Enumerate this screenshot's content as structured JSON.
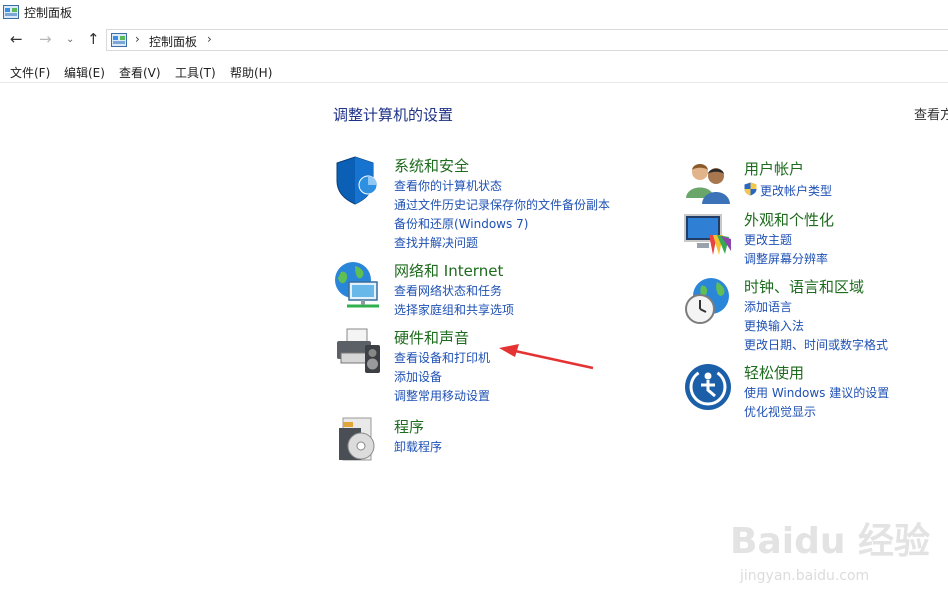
{
  "window": {
    "title": "控制面板"
  },
  "nav": {
    "breadcrumb": "控制面板"
  },
  "menu": [
    "文件(F)",
    "编辑(E)",
    "查看(V)",
    "工具(T)",
    "帮助(H)"
  ],
  "content": {
    "heading": "调整计算机的设置",
    "view_by": "查看方",
    "left_categories": [
      {
        "title": "系统和安全",
        "icon": "shield-icon",
        "links": [
          "查看你的计算机状态",
          "通过文件历史记录保存你的文件备份副本",
          "备份和还原(Windows 7)",
          "查找并解决问题"
        ]
      },
      {
        "title": "网络和 Internet",
        "icon": "network-globe-icon",
        "links": [
          "查看网络状态和任务",
          "选择家庭组和共享选项"
        ]
      },
      {
        "title": "硬件和声音",
        "icon": "printer-speaker-icon",
        "links": [
          "查看设备和打印机",
          "添加设备",
          "调整常用移动设置"
        ]
      },
      {
        "title": "程序",
        "icon": "programs-disc-icon",
        "links": [
          "卸载程序"
        ]
      }
    ],
    "right_categories": [
      {
        "title": "用户帐户",
        "icon": "users-icon",
        "links": [
          "更改帐户类型"
        ]
      },
      {
        "title": "外观和个性化",
        "icon": "monitor-palette-icon",
        "links": [
          "更改主题",
          "调整屏幕分辨率"
        ]
      },
      {
        "title": "时钟、语言和区域",
        "icon": "globe-clock-icon",
        "links": [
          "添加语言",
          "更换输入法",
          "更改日期、时间或数字格式"
        ]
      },
      {
        "title": "轻松使用",
        "icon": "ease-of-access-icon",
        "links": [
          "使用 Windows 建议的设置",
          "优化视觉显示"
        ]
      }
    ]
  },
  "watermark": {
    "brand": "Baidu 经验",
    "url": "jingyan.baidu.com"
  },
  "colors": {
    "category_title": "#1d6b1d",
    "link": "#1f51b4",
    "heading": "#1e3287",
    "arrow": "#e53333"
  }
}
